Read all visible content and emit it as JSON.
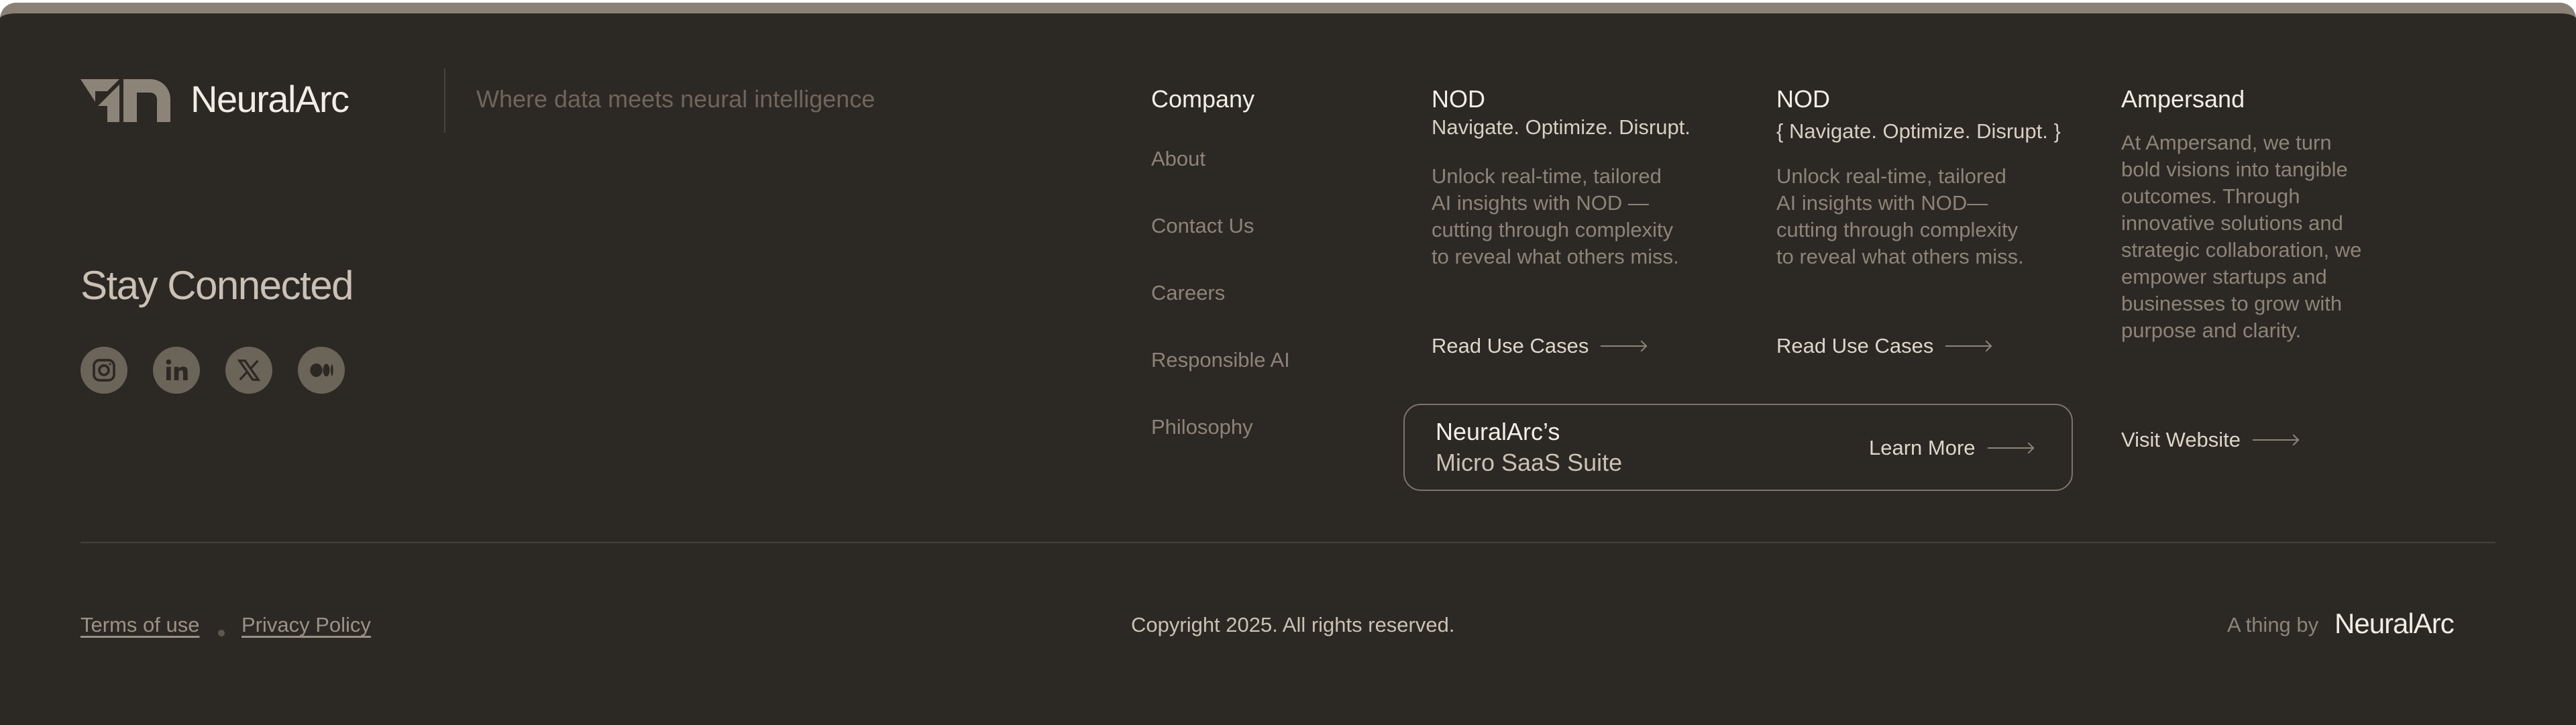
{
  "brand": {
    "name": "NeuralArc",
    "tagline": "Where data meets neural intelligence"
  },
  "social": {
    "heading": "Stay Connected",
    "icons": [
      "instagram-icon",
      "linkedin-icon",
      "x-icon",
      "medium-icon"
    ]
  },
  "company": {
    "title": "Company",
    "links": [
      "About",
      "Contact Us",
      "Careers",
      "Responsible AI",
      "Philosophy"
    ]
  },
  "nod1": {
    "title": "NOD",
    "subtitle": "Navigate. Optimize. Disrupt.",
    "desc": [
      "Unlock real-time, tailored",
      "AI insights with NOD —",
      "cutting through complexity",
      "to reveal what others miss."
    ],
    "cta": "Read Use Cases"
  },
  "nod2": {
    "title": "NOD",
    "subtitle": "{ Navigate. Optimize. Disrupt. }",
    "desc": [
      "Unlock real-time, tailored",
      "AI insights with NOD—",
      "cutting through complexity",
      "to reveal what others miss."
    ],
    "cta": "Read Use Cases"
  },
  "ampersand": {
    "title": "Ampersand",
    "desc": [
      "At Ampersand, we turn",
      "bold visions into tangible",
      "outcomes. Through",
      "innovative solutions and",
      "strategic collaboration, we",
      "empower startups and",
      "businesses to grow with",
      "purpose and clarity."
    ],
    "cta": "Visit Website"
  },
  "suite": {
    "line1": "NeuralArc’s",
    "line2": "Micro SaaS Suite",
    "cta": "Learn More"
  },
  "bottom": {
    "terms": "Terms of use",
    "privacy": "Privacy Policy",
    "copyright": "Copyright 2025.  All rights reserved.",
    "thing_by": "A thing by",
    "thing_by_brand": "NeuralArc"
  },
  "colors": {
    "background": "#2c2823",
    "top_band": "#8a8176",
    "text_primary": "#f3eee6",
    "text_muted": "#8c8479"
  }
}
